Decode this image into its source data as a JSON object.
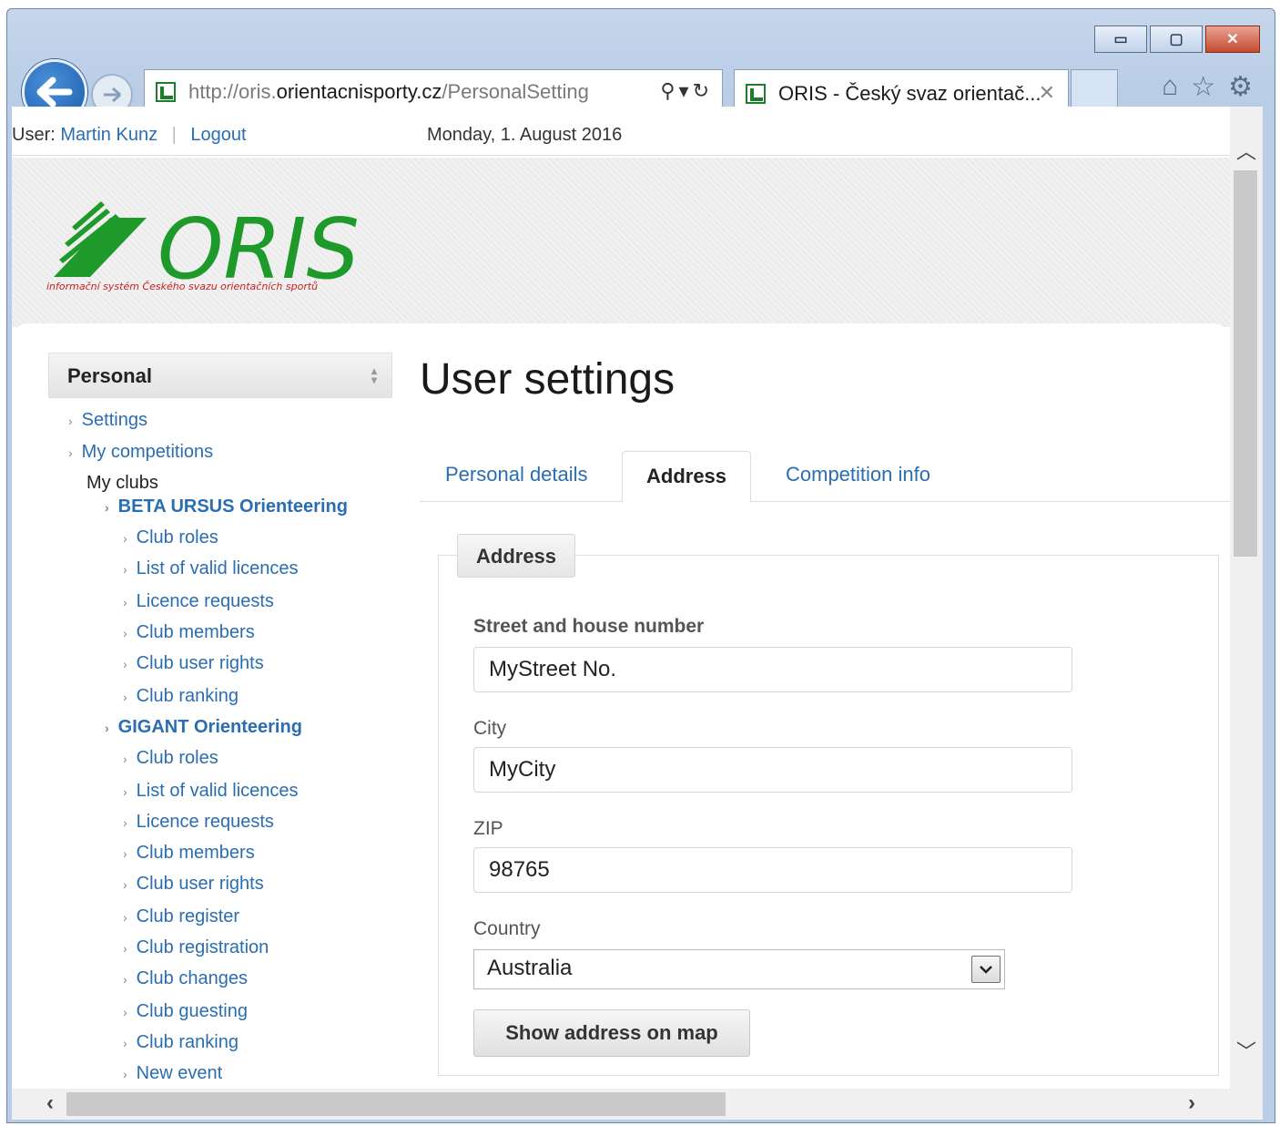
{
  "browser": {
    "url_prefix": "http://oris.",
    "url_host": "orientacnisporty.cz",
    "url_path": "/PersonalSetting",
    "tab_title": "ORIS - Český svaz orientač...",
    "window_buttons": {
      "minimize": "▭",
      "maximize": "▢",
      "close": "✕"
    }
  },
  "topbar": {
    "user_label": "User:",
    "user_name": "Martin Kunz",
    "logout": "Logout",
    "date": "Monday, 1. August 2016"
  },
  "header": {
    "logo_text": "ORIS",
    "tagline": "informační systém Českého svazu orientačních sportů",
    "brand_color": "#1e9a2a"
  },
  "sidebar": {
    "heading": "Personal",
    "items": [
      {
        "label": "Settings",
        "link": true
      },
      {
        "label": "My competitions",
        "link": true
      },
      {
        "label": "My clubs",
        "link": false
      },
      {
        "label": "BETA URSUS Orienteering",
        "link": true,
        "club": true
      },
      {
        "label": "Club roles",
        "link": true
      },
      {
        "label": "List of valid licences",
        "link": true
      },
      {
        "label": "Licence requests",
        "link": true
      },
      {
        "label": "Club members",
        "link": true
      },
      {
        "label": "Club user rights",
        "link": true
      },
      {
        "label": "Club ranking",
        "link": true
      },
      {
        "label": "GIGANT Orienteering",
        "link": true,
        "club": true
      },
      {
        "label": "Club roles",
        "link": true
      },
      {
        "label": "List of valid licences",
        "link": true
      },
      {
        "label": "Licence requests",
        "link": true
      },
      {
        "label": "Club members",
        "link": true
      },
      {
        "label": "Club user rights",
        "link": true
      },
      {
        "label": "Club register",
        "link": true
      },
      {
        "label": "Club registration",
        "link": true
      },
      {
        "label": "Club changes",
        "link": true
      },
      {
        "label": "Club guesting",
        "link": true
      },
      {
        "label": "Club ranking",
        "link": true
      },
      {
        "label": "New event",
        "link": true
      }
    ]
  },
  "main": {
    "title": "User settings",
    "tabs": [
      {
        "label": "Personal details",
        "active": false
      },
      {
        "label": "Address",
        "active": true
      },
      {
        "label": "Competition info",
        "active": false
      }
    ],
    "fieldset": {
      "legend": "Address",
      "street_label": "Street and house number",
      "street_value": "MyStreet No.",
      "city_label": "City",
      "city_value": "MyCity",
      "zip_label": "ZIP",
      "zip_value": "98765",
      "country_label": "Country",
      "country_value": "Australia",
      "map_button": "Show address on map"
    }
  },
  "colors": {
    "link": "#2a6db0",
    "chrome": "#b9cde6"
  }
}
